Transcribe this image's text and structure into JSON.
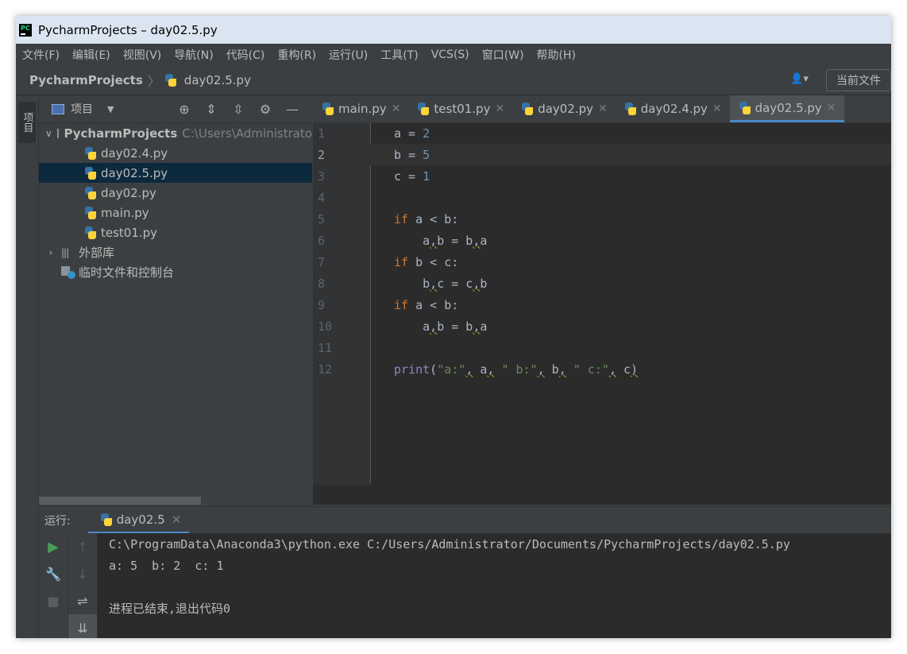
{
  "window": {
    "title": "PycharmProjects – day02.5.py"
  },
  "menu": [
    "文件(F)",
    "编辑(E)",
    "视图(V)",
    "导航(N)",
    "代码(C)",
    "重构(R)",
    "运行(U)",
    "工具(T)",
    "VCS(S)",
    "窗口(W)",
    "帮助(H)"
  ],
  "nav": {
    "project": "PycharmProjects",
    "file": "day02.5.py",
    "current_file_button": "当前文件"
  },
  "stripe": {
    "project_tab": "项目"
  },
  "project_panel": {
    "title": "项目",
    "root": {
      "name": "PycharmProjects",
      "path": "C:\\Users\\Administrato"
    },
    "files": [
      "day02.4.py",
      "day02.5.py",
      "day02.py",
      "main.py",
      "test01.py"
    ],
    "selected": "day02.5.py",
    "external_libs": "外部库",
    "scratches": "临时文件和控制台"
  },
  "editor": {
    "tabs": [
      "main.py",
      "test01.py",
      "day02.py",
      "day02.4.py",
      "day02.5.py"
    ],
    "active_tab": "day02.5.py",
    "line_numbers": [
      "1",
      "2",
      "3",
      "4",
      "5",
      "6",
      "7",
      "8",
      "9",
      "10",
      "11",
      "12"
    ],
    "current_line": 2
  },
  "run_panel": {
    "label": "运行:",
    "tab": "day02.5",
    "output": [
      "C:\\ProgramData\\Anaconda3\\python.exe C:/Users/Administrator/Documents/PycharmProjects/day02.5.py",
      "a: 5  b: 2  c: 1",
      "",
      "进程已结束,退出代码0"
    ]
  }
}
